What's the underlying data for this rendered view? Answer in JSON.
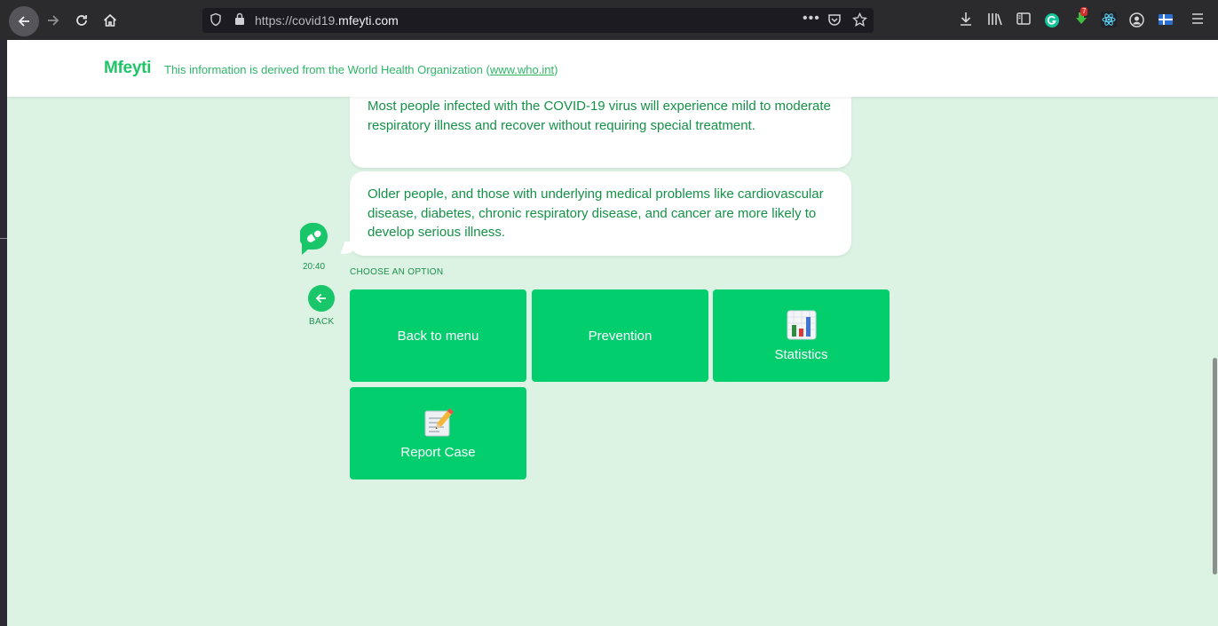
{
  "browser": {
    "url_prefix": "https://covid19.",
    "url_domain": "mfeyti.com",
    "badge_count": "7"
  },
  "header": {
    "brand": "Mfeyti",
    "info_text": "This information is derived from the World Health Organization (",
    "info_link": "www.who.int",
    "info_end": ")"
  },
  "chat": {
    "messages": [
      "Most people infected with the COVID-19 virus will experience mild to moderate respiratory illness and recover without requiring special treatment.",
      "Older people, and those with underlying medical problems like cardiovascular disease, diabetes, chronic respiratory disease, and cancer are more likely to develop serious illness."
    ],
    "time": "20:40",
    "back_label": "BACK",
    "choose_label": "CHOOSE AN OPTION",
    "options": [
      {
        "label": "Back to menu"
      },
      {
        "label": "Prevention"
      },
      {
        "label": "Statistics",
        "icon": "bar-chart-icon"
      },
      {
        "label": "Report Case",
        "icon": "memo-icon"
      }
    ]
  },
  "colors": {
    "brand_green": "#1fc467",
    "button_green": "#02ce6d",
    "page_bg": "#dcf3e3",
    "text_green": "#149147"
  }
}
